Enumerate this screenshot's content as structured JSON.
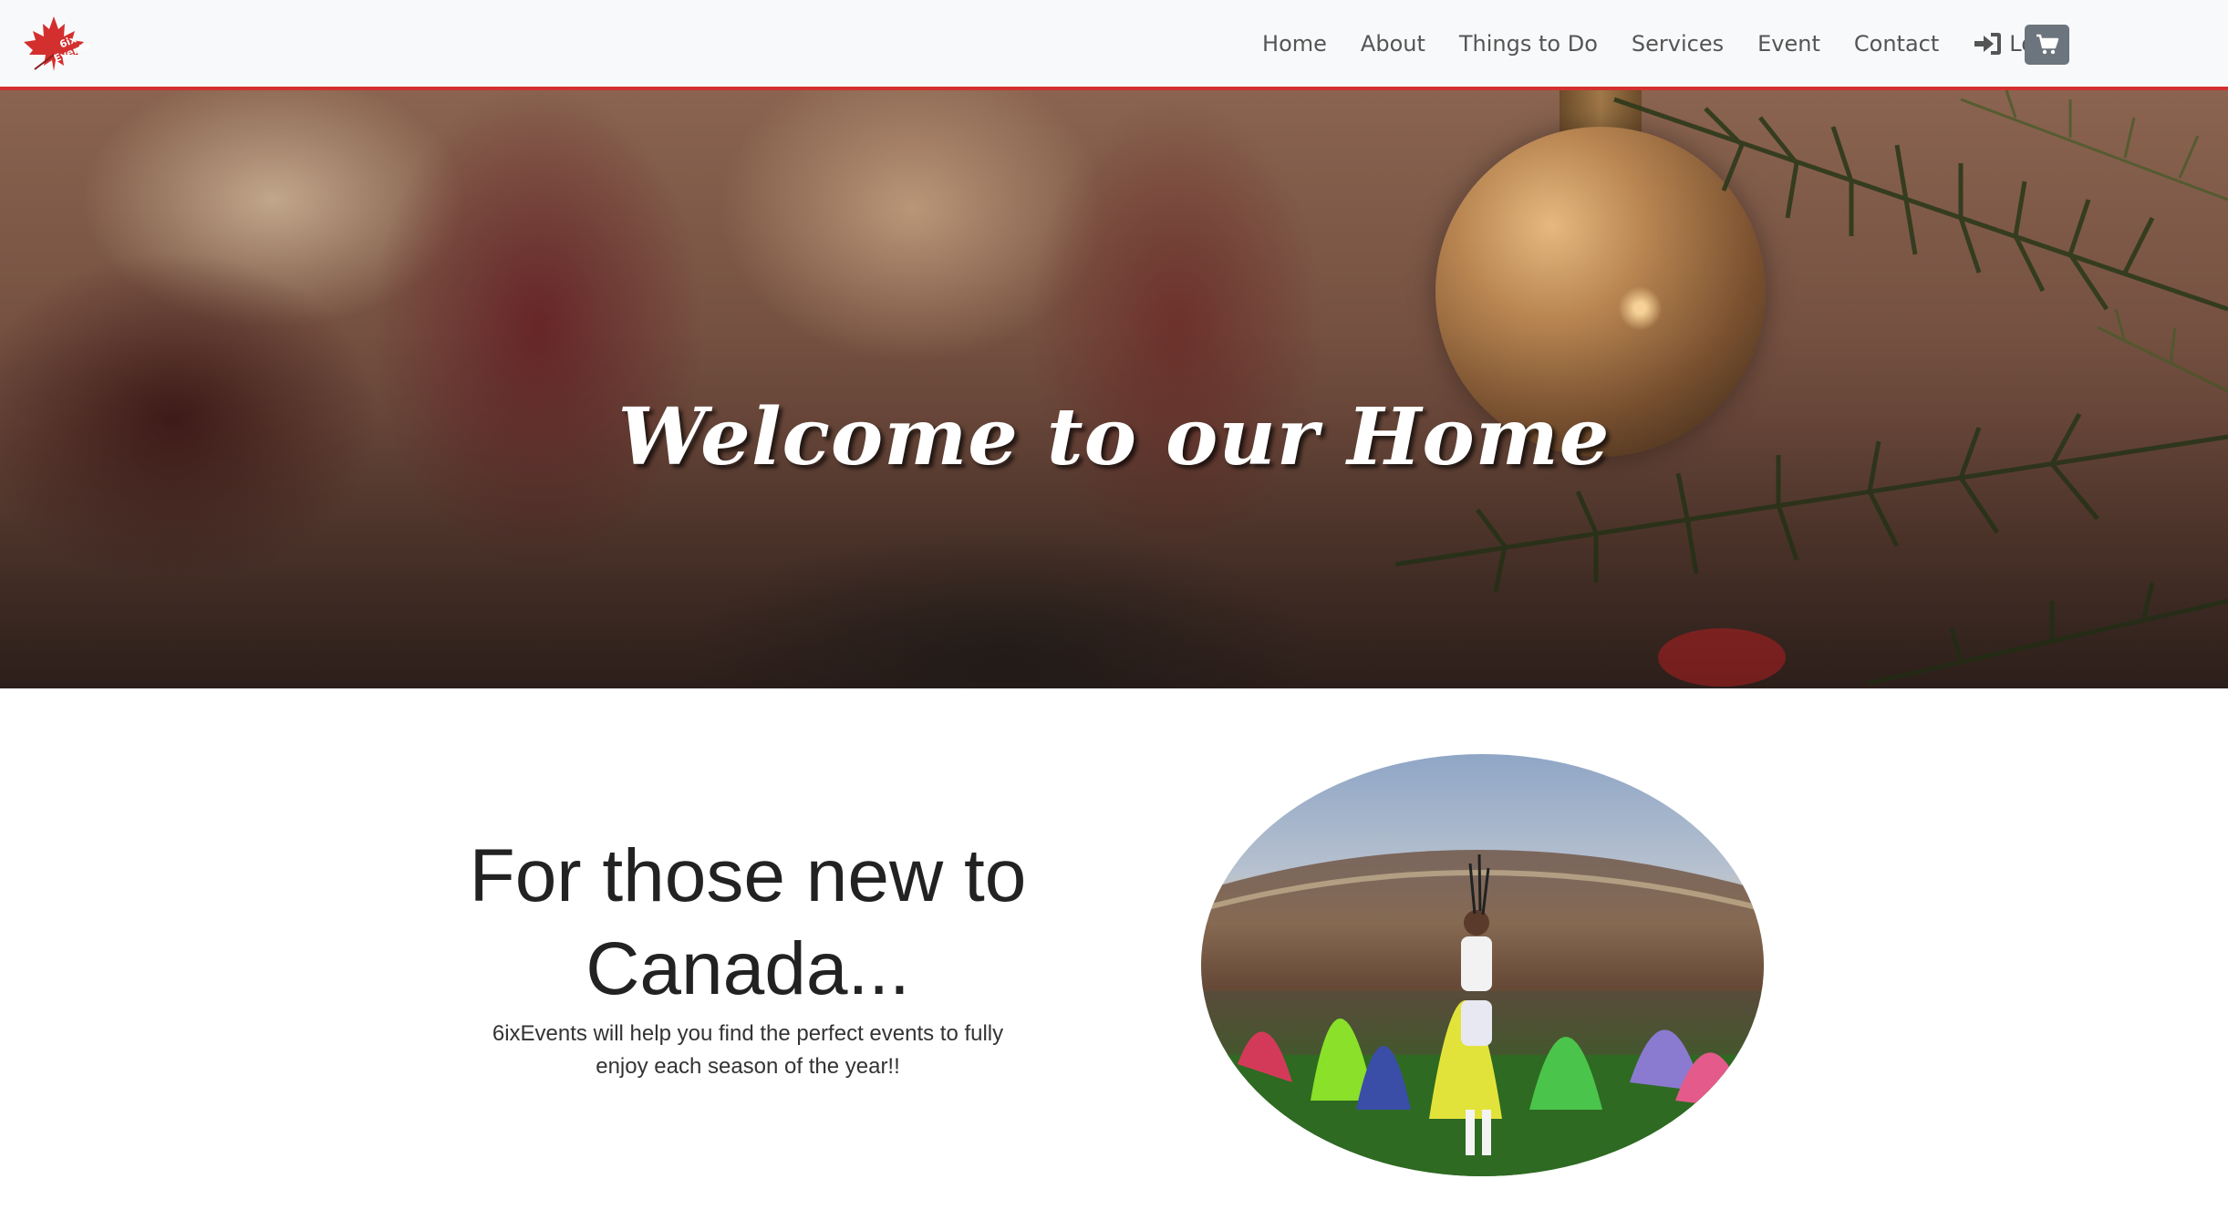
{
  "brand": {
    "logo_text": "6ix Events",
    "accent": "#d32f2f"
  },
  "nav": {
    "items": [
      {
        "label": "Home"
      },
      {
        "label": "About"
      },
      {
        "label": "Things to Do"
      },
      {
        "label": "Services"
      },
      {
        "label": "Event"
      },
      {
        "label": "Contact"
      }
    ],
    "login_label": "Login",
    "login_icon": "sign-in-icon",
    "cart_icon": "shopping-cart-icon"
  },
  "hero": {
    "title": "Welcome to our Home"
  },
  "intro": {
    "heading": "For those new to Canada...",
    "text": "6ixEvents will help you find the perfect events to fully enjoy each season of the year!!"
  }
}
